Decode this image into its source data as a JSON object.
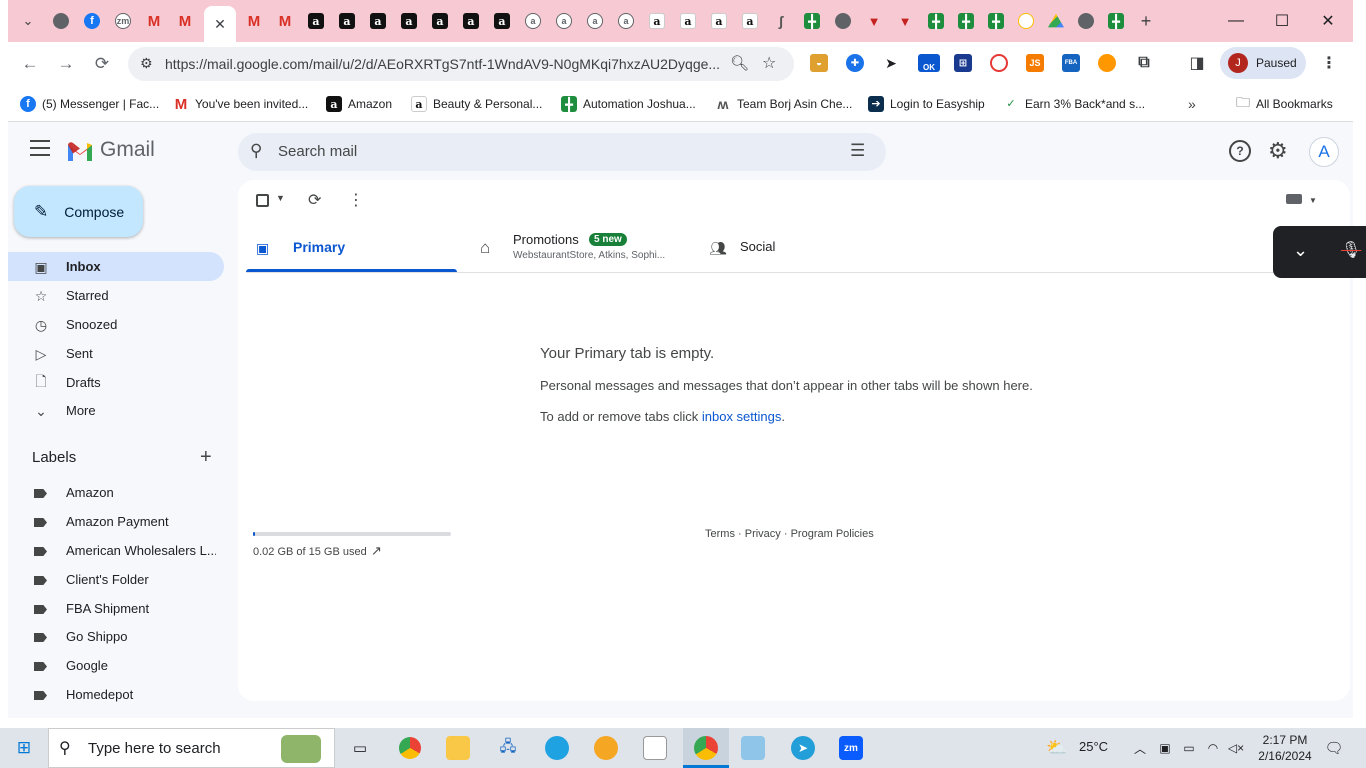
{
  "browser": {
    "url": "https://mail.google.com/mail/u/2/d/AEoRXRTgS7ntf-1WndAV9-N0gMKqi7hxzAU2Dyqge...",
    "profile_initial": "J",
    "profile_status": "Paused",
    "new_tab": "+",
    "tab_close": "✕",
    "bookmarks": [
      {
        "label": "(5) Messenger | Fac...",
        "icon": "facebook-icon"
      },
      {
        "label": "You've been invited...",
        "icon": "gmail-icon"
      },
      {
        "label": "Amazon",
        "icon": "amazon-icon"
      },
      {
        "label": "Beauty & Personal...",
        "icon": "amazon-icon"
      },
      {
        "label": "Automation Joshua...",
        "icon": "sheets-icon"
      },
      {
        "label": "Team Borj Asin Che...",
        "icon": "wix-icon"
      },
      {
        "label": "Login to Easyship",
        "icon": "easyship-icon"
      },
      {
        "label": "Earn 3% Back*and s...",
        "icon": "rakuten-icon"
      }
    ],
    "all_bookmarks": "All Bookmarks",
    "ext_ok_badge": "OK",
    "ext_js": "JS",
    "ext_fba": "FBA"
  },
  "gmail": {
    "logo": "Gmail",
    "search_placeholder": "Search mail",
    "account_initial": "A",
    "compose": "Compose",
    "nav": [
      {
        "label": "Inbox",
        "icon": "inbox-icon",
        "active": true
      },
      {
        "label": "Starred",
        "icon": "star-icon"
      },
      {
        "label": "Snoozed",
        "icon": "clock-icon"
      },
      {
        "label": "Sent",
        "icon": "send-icon"
      },
      {
        "label": "Drafts",
        "icon": "draft-icon"
      },
      {
        "label": "More",
        "icon": "chevron-down-icon"
      }
    ],
    "labels_title": "Labels",
    "labels": [
      "Amazon",
      "Amazon Payment",
      "American Wholesalers L...",
      "Client's Folder",
      "FBA Shipment",
      "Go Shippo",
      "Google",
      "Homedepot"
    ],
    "tabs": {
      "primary": "Primary",
      "promotions": "Promotions",
      "promotions_badge": "5 new",
      "promotions_senders": "WebstaurantStore, Atkins, Sophi...",
      "social": "Social"
    },
    "empty": {
      "title": "Your Primary tab is empty.",
      "line1": "Personal messages and messages that don’t appear in other tabs will be shown here.",
      "line2_prefix": "To add or remove tabs click ",
      "line2_link": "inbox settings",
      "line2_suffix": "."
    },
    "storage": "0.02 GB of 15 GB used",
    "storage_fraction": 0.0013,
    "footer": {
      "terms": "Terms",
      "sep": " · ",
      "privacy": "Privacy",
      "policies": "Program Policies"
    }
  },
  "taskbar": {
    "search_placeholder": "Type here to search",
    "weather": "25°C",
    "time": "2:17 PM",
    "date": "2/16/2024",
    "zoom_label": "zm"
  },
  "colors": {
    "accent": "#0b57d0",
    "inbox_active": "#d3e3fd",
    "compose": "#c2e7ff",
    "tabstrip": "#f7cad3",
    "badge": "#188038"
  }
}
